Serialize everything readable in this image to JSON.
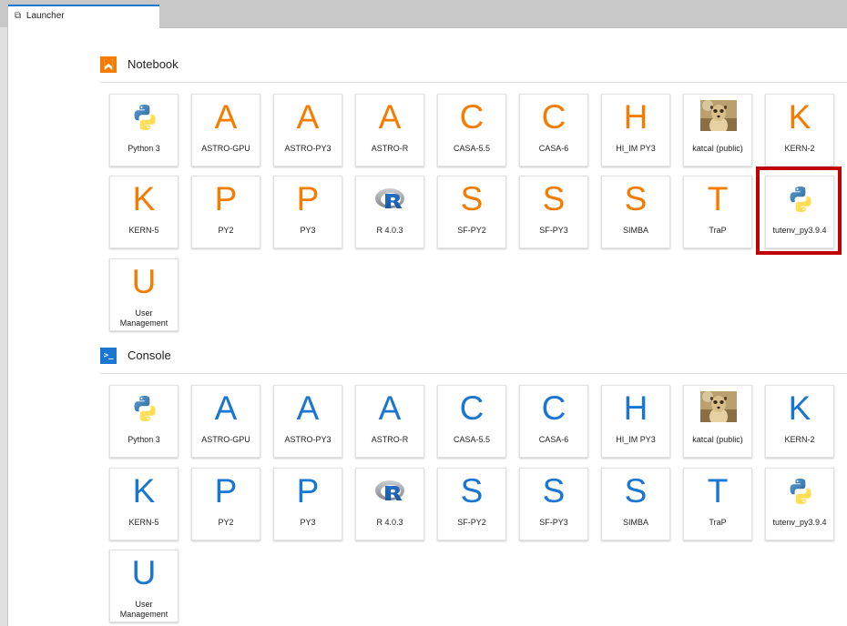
{
  "tab": {
    "icon": "external-link-icon",
    "label": "Launcher"
  },
  "sections": [
    {
      "id": "notebook",
      "title": "Notebook",
      "icon": "notebook-bookmark-icon"
    },
    {
      "id": "console",
      "title": "Console",
      "icon": "console-prompt-icon",
      "icon_text": ">_"
    }
  ],
  "kernels": [
    {
      "label": "Python 3",
      "icon": "python-logo-icon"
    },
    {
      "label": "ASTRO-GPU",
      "letter": "A"
    },
    {
      "label": "ASTRO-PY3",
      "letter": "A"
    },
    {
      "label": "ASTRO-R",
      "letter": "A"
    },
    {
      "label": "CASA-5.5",
      "letter": "C"
    },
    {
      "label": "CASA-6",
      "letter": "C"
    },
    {
      "label": "HI_IM PY3",
      "letter": "H"
    },
    {
      "label": "katcal (public)",
      "icon": "meerkat-logo-icon"
    },
    {
      "label": "KERN-2",
      "letter": "K"
    },
    {
      "label": "KERN-5",
      "letter": "K"
    },
    {
      "label": "PY2",
      "letter": "P"
    },
    {
      "label": "PY3",
      "letter": "P"
    },
    {
      "label": "R 4.0.3",
      "icon": "r-logo-icon"
    },
    {
      "label": "SF-PY2",
      "letter": "S"
    },
    {
      "label": "SF-PY3",
      "letter": "S"
    },
    {
      "label": "SIMBA",
      "letter": "S"
    },
    {
      "label": "TraP",
      "letter": "T"
    },
    {
      "label": "tutenv_py3.9.4",
      "icon": "python-logo-icon"
    },
    {
      "label": "User Management",
      "letter": "U"
    }
  ],
  "highlight": {
    "section": "notebook",
    "item": "tutenv_py3.9.4",
    "color": "#c00000"
  },
  "colors": {
    "notebook_accent": "#f57c00",
    "console_accent": "#1976d2",
    "tab_active": "#1976d2"
  }
}
